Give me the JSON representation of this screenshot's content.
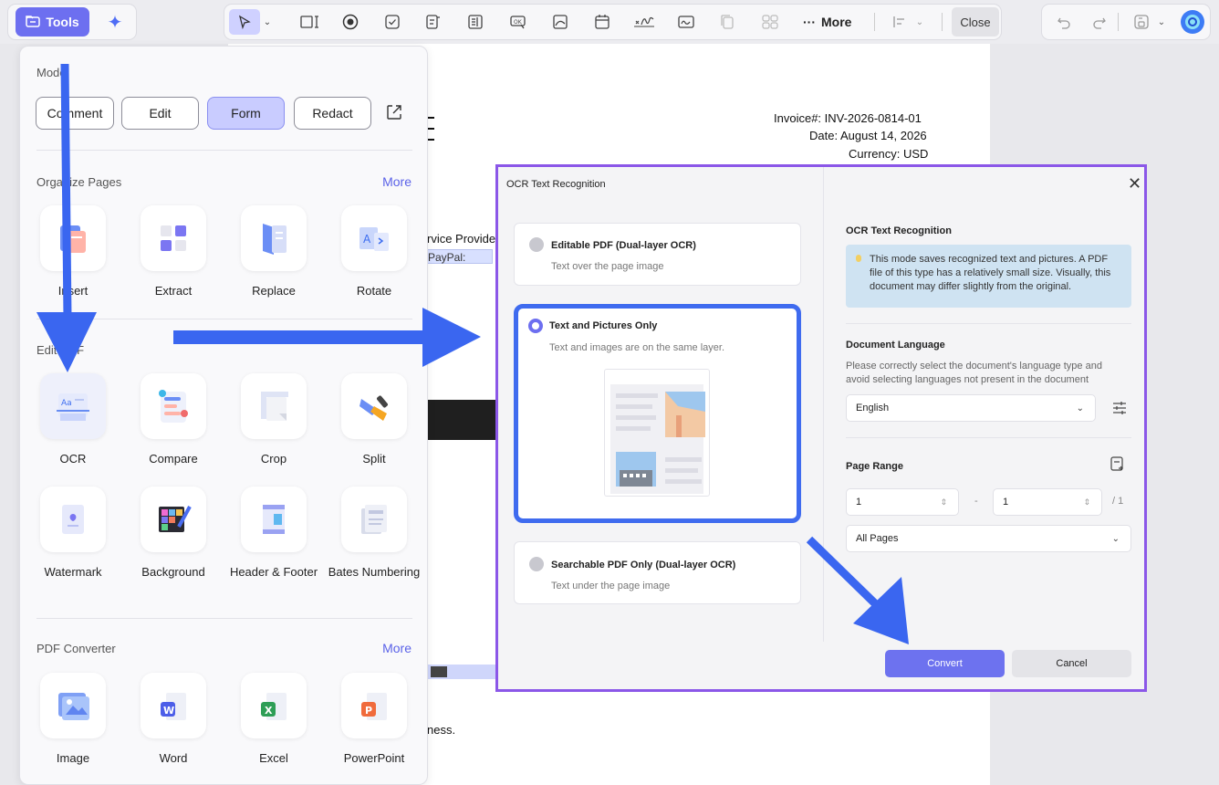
{
  "toolbar": {
    "tools_label": "Tools",
    "more_label": "More",
    "close_label": "Close"
  },
  "document": {
    "invoice_no": "Invoice#: INV-2026-0814-01",
    "date": "Date: August 14, 2026",
    "currency": "Currency: USD",
    "service_provider": "rvice Provide",
    "paypal": "PayPal:",
    "closing": "ness."
  },
  "tools_panel": {
    "mode": {
      "title": "Mode",
      "buttons": [
        "Comment",
        "Edit",
        "Form",
        "Redact"
      ],
      "active": "Form"
    },
    "organize": {
      "title": "Organize Pages",
      "more": "More",
      "items": [
        "Insert",
        "Extract",
        "Replace",
        "Rotate"
      ]
    },
    "edit": {
      "title": "Edit PDF",
      "items": [
        "OCR",
        "Compare",
        "Crop",
        "Split",
        "Watermark",
        "Background",
        "Header & Footer",
        "Bates Numbering"
      ]
    },
    "converter": {
      "title": "PDF Converter",
      "more": "More",
      "items": [
        "Image",
        "Word",
        "Excel",
        "PowerPoint"
      ]
    }
  },
  "dialog": {
    "title": "OCR Text Recognition",
    "options": [
      {
        "title": "Editable PDF (Dual-layer OCR)",
        "desc": "Text over the page image"
      },
      {
        "title": "Text and Pictures Only",
        "desc": "Text and images are on the same layer."
      },
      {
        "title": "Searchable PDF Only (Dual-layer OCR)",
        "desc": "Text under the page image"
      }
    ],
    "selected_option": "Text and Pictures Only",
    "section_ocr": "OCR Text Recognition",
    "info": "This mode saves recognized text and pictures. A PDF file of this type has a relatively small size. Visually, this document may differ slightly from the original.",
    "language": {
      "title": "Document Language",
      "desc": "Please correctly select the document's language type and avoid selecting languages not present in the document",
      "value": "English"
    },
    "page_range": {
      "title": "Page Range",
      "from": "1",
      "separator": "-",
      "to": "1",
      "total": "/ 1",
      "mode": "All Pages"
    },
    "convert_label": "Convert",
    "cancel_label": "Cancel"
  },
  "colors": {
    "accent": "#6d6ff0",
    "dialog_border": "#8b57e8",
    "annotation_arrow": "#3a66f0"
  }
}
